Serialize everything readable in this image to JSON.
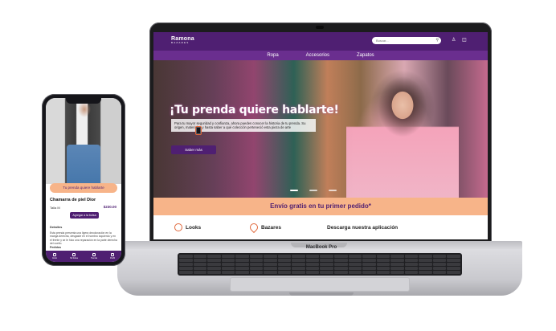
{
  "laptop": {
    "brand": "MacBook Pro"
  },
  "site": {
    "logo_name": "Ramona",
    "logo_sub": "BAZARES",
    "search_placeholder": "Buscar...",
    "nav": [
      "Ropa",
      "Accesorios",
      "Zapatos"
    ],
    "hero": {
      "title": "¡Tu prenda quiere hablarte!",
      "text": "Para tu mayor seguridad y confianza, ahora puedes conocer la historia de tu prenda. Su origen, materiales y hasta saber a qué colección perteneció esta pieza de arte",
      "cta": "Saber más",
      "slides": 3,
      "active_slide": 1
    },
    "promo": "Envío gratis en tu primer pedido*",
    "features": [
      {
        "label": "Looks",
        "icon": "lips-icon"
      },
      {
        "label": "Bazares",
        "icon": "location-pin-icon"
      },
      {
        "label": "Descarga nuestra aplicación",
        "icon": "phone-icon"
      }
    ],
    "colors": {
      "primary": "#4f1f72",
      "nav": "#6a2e8f",
      "accent": "#f7b489",
      "icon": "#e0673a"
    }
  },
  "phone": {
    "pill": "Tu prenda quiere hablarte",
    "product_title": "Chamarra de piel Dior",
    "size": "Talla M",
    "price": "$230.00",
    "add_button": "Agregar a la bolsa",
    "details_heading": "Detalles",
    "details_text": "Esta prenda presenta una ligera decoloración en la manga derecha, desgaste en el hombro izquierdo y en el frente y se le hizo una reparación en la parte derecha del cuello.",
    "orders_heading": "Pedidos",
    "tabs": [
      "Inicio",
      "Mi bolsa",
      "Tienda",
      "Perfil"
    ]
  }
}
